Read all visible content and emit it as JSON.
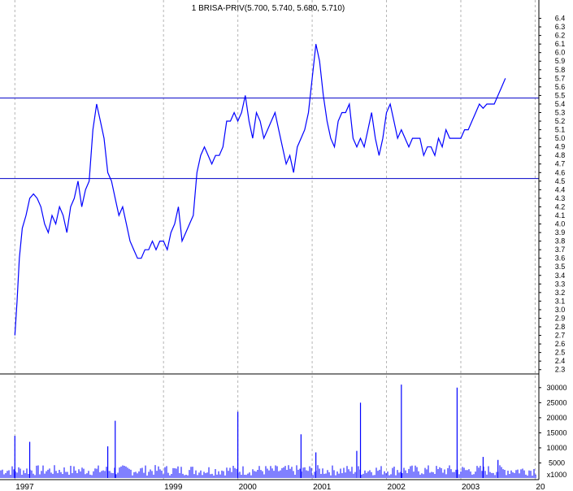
{
  "chart_data": {
    "type": "line",
    "title": "1 BRISA-PRIV(5.700, 5.740, 5.680, 5.710)",
    "price": {
      "ylim": [
        2.25,
        6.5
      ],
      "yticks": [
        "6.4",
        "6.3",
        "6.2",
        "6.1",
        "6.0",
        "5.9",
        "5.8",
        "5.7",
        "5.6",
        "5.5",
        "5.4",
        "5.3",
        "5.2",
        "5.1",
        "5.0",
        "4.9",
        "4.8",
        "4.7",
        "4.6",
        "4.5",
        "4.4",
        "4.3",
        "4.2",
        "4.1",
        "4.0",
        "3.9",
        "3.8",
        "3.7",
        "3.6",
        "3.5",
        "3.4",
        "3.3",
        "3.2",
        "3.1",
        "3.0",
        "2.9",
        "2.8",
        "2.7",
        "2.6",
        "2.5",
        "2.4",
        "2.3"
      ],
      "reference_lines": [
        5.47,
        4.53
      ],
      "series": [
        {
          "values_x": [
            1997.0,
            1997.03,
            1997.06,
            1997.1,
            1997.15,
            1997.2,
            1997.25,
            1997.3,
            1997.35,
            1997.4,
            1997.45,
            1997.5,
            1997.55,
            1997.6,
            1997.65,
            1997.7,
            1997.75,
            1997.8,
            1997.85,
            1997.9,
            1997.95,
            1998.0,
            1998.05,
            1998.1,
            1998.15,
            1998.2,
            1998.25,
            1998.3,
            1998.35,
            1998.4,
            1998.45,
            1998.5,
            1998.55,
            1998.6,
            1998.65,
            1998.7,
            1998.75,
            1998.8,
            1998.85,
            1998.9,
            1998.95,
            1999.0,
            1999.05,
            1999.1,
            1999.15,
            1999.2,
            1999.25,
            1999.3,
            1999.35,
            1999.4,
            1999.45,
            1999.5,
            1999.55,
            1999.6,
            1999.65,
            1999.7,
            1999.75,
            1999.8,
            1999.85,
            1999.9,
            1999.95,
            2000.0,
            2000.05,
            2000.1,
            2000.15,
            2000.2,
            2000.25,
            2000.3,
            2000.35,
            2000.4,
            2000.45,
            2000.5,
            2000.55,
            2000.6,
            2000.65,
            2000.7,
            2000.75,
            2000.8,
            2000.85,
            2000.9,
            2000.95,
            2001.0,
            2001.05,
            2001.1,
            2001.15,
            2001.2,
            2001.25,
            2001.3,
            2001.35,
            2001.4,
            2001.45,
            2001.5,
            2001.55,
            2001.6,
            2001.65,
            2001.7,
            2001.75,
            2001.8,
            2001.85,
            2001.9,
            2001.95,
            2002.0,
            2002.05,
            2002.1,
            2002.15,
            2002.2,
            2002.25,
            2002.3,
            2002.35,
            2002.4,
            2002.45,
            2002.5,
            2002.55,
            2002.6,
            2002.65,
            2002.7,
            2002.75,
            2002.8,
            2002.85,
            2002.9,
            2002.95,
            2003.0,
            2003.05,
            2003.1,
            2003.15,
            2003.2,
            2003.25,
            2003.3,
            2003.35,
            2003.4,
            2003.45,
            2003.5,
            2003.55,
            2003.6,
            2003.65,
            2003.7,
            2003.75,
            2003.8,
            2003.85,
            2003.9,
            2003.95,
            2004.0
          ],
          "values_y": [
            2.7,
            3.1,
            3.6,
            3.95,
            4.1,
            4.3,
            4.35,
            4.3,
            4.2,
            4.0,
            3.9,
            4.1,
            4.0,
            4.2,
            4.1,
            3.9,
            4.2,
            4.3,
            4.5,
            4.2,
            4.4,
            4.5,
            5.1,
            5.4,
            5.2,
            5.0,
            4.6,
            4.5,
            4.3,
            4.1,
            4.2,
            4.0,
            3.8,
            3.7,
            3.6,
            3.6,
            3.7,
            3.7,
            3.8,
            3.7,
            3.8,
            3.8,
            3.7,
            3.9,
            4.0,
            4.2,
            3.8,
            3.9,
            4.0,
            4.1,
            4.6,
            4.8,
            4.9,
            4.8,
            4.7,
            4.8,
            4.8,
            4.9,
            5.2,
            5.2,
            5.3,
            5.2,
            5.3,
            5.5,
            5.2,
            5.0,
            5.3,
            5.2,
            5.0,
            5.1,
            5.2,
            5.3,
            5.1,
            4.9,
            4.7,
            4.8,
            4.6,
            4.9,
            5.0,
            5.1,
            5.3,
            5.7,
            6.1,
            5.9,
            5.5,
            5.2,
            5.0,
            4.9,
            5.2,
            5.3,
            5.3,
            5.4,
            5.0,
            4.9,
            5.0,
            4.9,
            5.1,
            5.3,
            5.0,
            4.8,
            5.0,
            5.3,
            5.4,
            5.2,
            5.0,
            5.1,
            5.0,
            4.9,
            5.0,
            5.0,
            5.0,
            4.8,
            4.9,
            4.9,
            4.8,
            5.0,
            4.9,
            5.1,
            5.0,
            5.0,
            5.0,
            5.0,
            5.1,
            5.1,
            5.2,
            5.3,
            5.4,
            5.35,
            5.4,
            5.4,
            5.4,
            5.5,
            5.6,
            5.7
          ]
        }
      ]
    },
    "volume": {
      "ylim": [
        0,
        34000
      ],
      "yticks": [
        "30000",
        "25000",
        "20000",
        "15000",
        "10000",
        "5000",
        "x1000"
      ]
    },
    "x_ticks": [
      "1997",
      "1999",
      "2000",
      "2001",
      "2002",
      "2003",
      "20"
    ],
    "xlim": [
      1996.8,
      2004.05
    ]
  }
}
